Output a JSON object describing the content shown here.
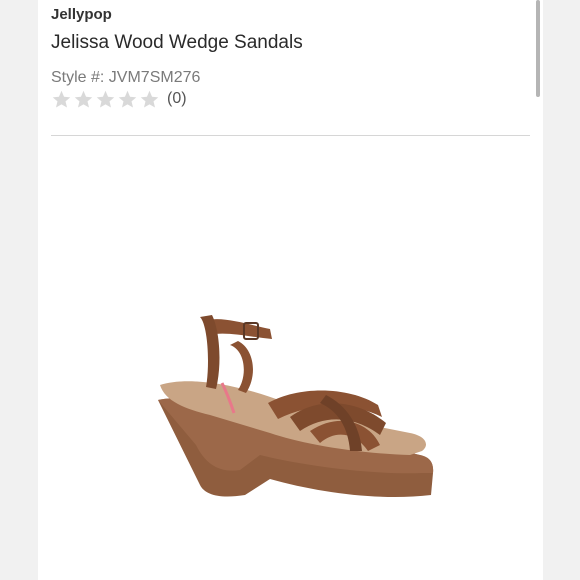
{
  "product": {
    "brand": "Jellypop",
    "title": "Jelissa Wood Wedge Sandals",
    "style": "Style #: JVM7SM276",
    "rating": {
      "stars_filled": 0,
      "stars_total": 5,
      "count_text": "(0)"
    },
    "image": {
      "subject_icon": "wedge-sandal-image",
      "colors": {
        "leather": "#8b5233",
        "wood": "#9a6a4a",
        "cork": "#c9a585"
      }
    }
  },
  "colors": {
    "star_empty": "#d9d9d9",
    "divider": "#d6d6d6",
    "text_primary": "#2a2a2a",
    "text_secondary": "#7a7a7a"
  }
}
